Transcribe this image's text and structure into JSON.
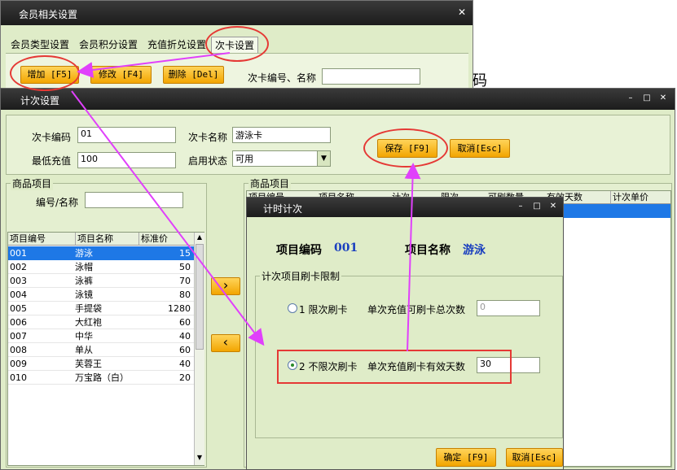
{
  "win1": {
    "title": "会员相关设置",
    "close": "✕",
    "tabs": [
      "会员类型设置",
      "会员积分设置",
      "充值折兑设置",
      "次卡设置"
    ],
    "btn_add": "增加 [F5]",
    "btn_edit": "修改 [F4]",
    "btn_delete": "删除 [Del]",
    "search_label": "次卡编号、名称",
    "search_value": ""
  },
  "bg_text": "码",
  "win2": {
    "title": "计次设置",
    "min": "–",
    "max": "□",
    "close": "✕",
    "card_no_label": "次卡编码",
    "card_no": "01",
    "card_name_label": "次卡名称",
    "card_name": "游泳卡",
    "min_charge_label": "最低充值",
    "min_charge": "100",
    "status_label": "启用状态",
    "status": "可用",
    "save": "保存 [F9]",
    "cancel": "取消[Esc]",
    "left_group": "商品项目",
    "filter_label": "编号/名称",
    "filter_value": "",
    "right_group": "商品项目",
    "move_right": "›",
    "move_left": "‹",
    "left_headers": [
      "项目编号",
      "项目名称",
      "标准价"
    ],
    "items": [
      {
        "code": "001",
        "name": "游泳",
        "price": "15"
      },
      {
        "code": "002",
        "name": "泳帽",
        "price": "50"
      },
      {
        "code": "003",
        "name": "泳裤",
        "price": "70"
      },
      {
        "code": "004",
        "name": "泳镜",
        "price": "80"
      },
      {
        "code": "005",
        "name": "手提袋",
        "price": "1280"
      },
      {
        "code": "006",
        "name": "大红袍",
        "price": "60"
      },
      {
        "code": "007",
        "name": "中华",
        "price": "40"
      },
      {
        "code": "008",
        "name": "单从",
        "price": "60"
      },
      {
        "code": "009",
        "name": "芙蓉王",
        "price": "40"
      },
      {
        "code": "010",
        "name": "万宝路（白）",
        "price": "20"
      }
    ],
    "right_headers": [
      "项目编号",
      "项目名称",
      "计次",
      "限次",
      "可刷数量",
      "有效天数",
      "计次单价"
    ]
  },
  "win3": {
    "title": "计时计次",
    "min": "–",
    "max": "□",
    "close": "✕",
    "code_label": "项目编码",
    "code_value": "001",
    "name_label": "项目名称",
    "name_value": "游泳",
    "group": "计次项目刷卡限制",
    "opt1_label": "1 限次刷卡",
    "opt1_field_label": "单次充值可刷卡总次数",
    "opt1_value": "0",
    "opt2_label": "2 不限次刷卡",
    "opt2_field_label": "单次充值刷卡有效天数",
    "opt2_value": "30",
    "ok": "确定 [F9]",
    "cancel": "取消[Esc]"
  },
  "colors": {
    "panel": "#dfecc8",
    "title_bar": "#2a2a2a",
    "selection": "#1e78e6",
    "annotation_red": "#e53935",
    "annotation_magenta": "#e040fb",
    "orange_button": "#f2a500"
  }
}
